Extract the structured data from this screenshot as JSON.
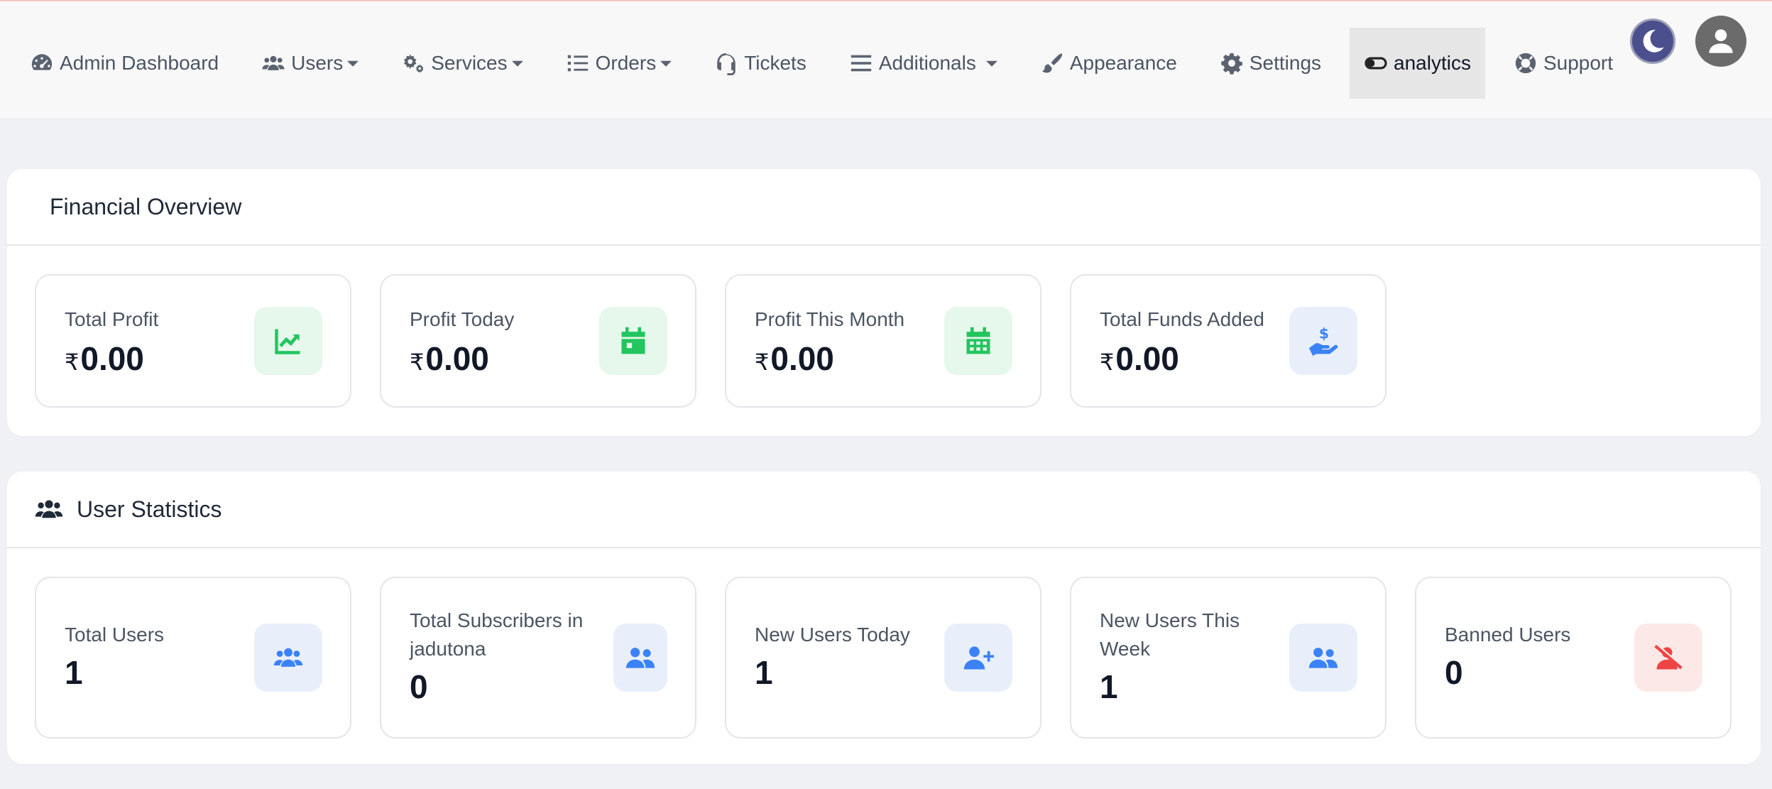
{
  "nav": {
    "items": [
      {
        "label": "Admin Dashboard",
        "icon": "gauge-icon"
      },
      {
        "label": "Users",
        "icon": "users-icon",
        "dropdown": true
      },
      {
        "label": "Services",
        "icon": "gears-icon",
        "dropdown": true
      },
      {
        "label": "Orders",
        "icon": "list-icon",
        "dropdown": true
      },
      {
        "label": "Tickets",
        "icon": "headset-icon"
      },
      {
        "label": "Additionals",
        "icon": "bars-icon",
        "dropdown": true
      },
      {
        "label": "Appearance",
        "icon": "brush-icon"
      },
      {
        "label": "Settings",
        "icon": "gear-icon"
      },
      {
        "label": "analytics",
        "icon": "toggle-icon",
        "active": true
      },
      {
        "label": "Support",
        "icon": "life-ring-icon"
      }
    ]
  },
  "financial": {
    "title": "Financial Overview",
    "currency": "₹",
    "cards": [
      {
        "label": "Total Profit",
        "value": "0.00",
        "icon": "chart-line-icon"
      },
      {
        "label": "Profit Today",
        "value": "0.00",
        "icon": "calendar-icon"
      },
      {
        "label": "Profit This Month",
        "value": "0.00",
        "icon": "calendar-grid-icon"
      },
      {
        "label": "Total Funds Added",
        "value": "0.00",
        "icon": "hand-dollar-icon"
      }
    ]
  },
  "users": {
    "title": "User Statistics",
    "cards": [
      {
        "label": "Total Users",
        "value": "1",
        "icon": "users-icon"
      },
      {
        "label": "Total Subscribers in jadutona",
        "value": "0",
        "icon": "user-group-icon"
      },
      {
        "label": "New Users Today",
        "value": "1",
        "icon": "user-plus-icon"
      },
      {
        "label": "New Users This Week",
        "value": "1",
        "icon": "user-group-icon"
      },
      {
        "label": "Banned Users",
        "value": "0",
        "icon": "user-slash-icon"
      }
    ]
  },
  "colors": {
    "accent_green": "#22c55e",
    "accent_blue": "#3b82f6",
    "accent_red": "#ef4444",
    "active_nav_bg": "#e6e6e6"
  }
}
